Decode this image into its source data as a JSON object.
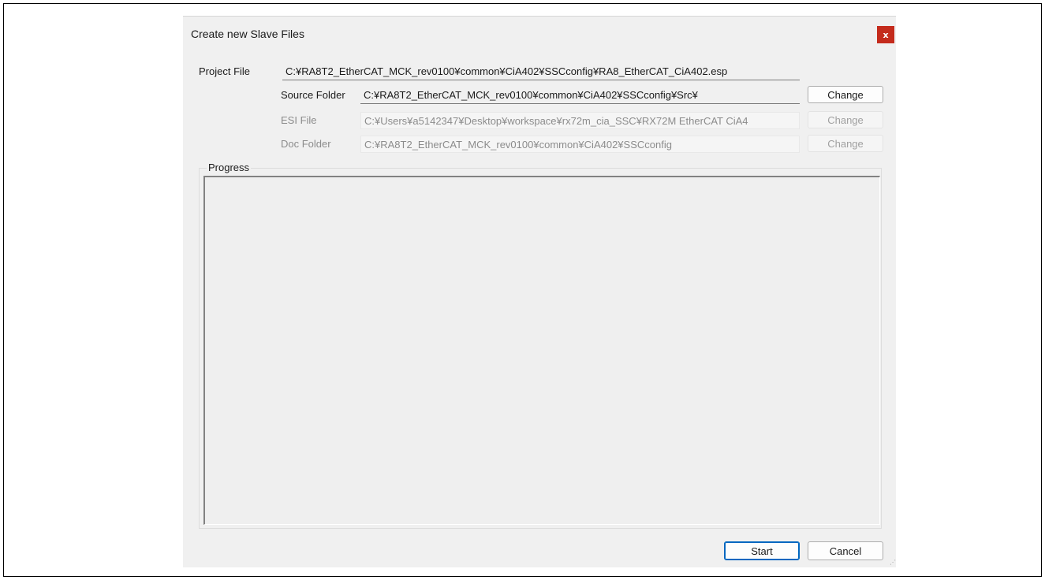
{
  "dialog": {
    "title": "Create new Slave Files",
    "close_label": "x"
  },
  "form": {
    "project_file": {
      "label": "Project File",
      "value": "C:¥RA8T2_EtherCAT_MCK_rev0100¥common¥CiA402¥SSCconfig¥RA8_EtherCAT_CiA402.esp"
    },
    "source_folder": {
      "label": "Source Folder",
      "value": "C:¥RA8T2_EtherCAT_MCK_rev0100¥common¥CiA402¥SSCconfig¥Src¥",
      "button": "Change"
    },
    "esi_file": {
      "label": "ESI File",
      "value": "C:¥Users¥a5142347¥Desktop¥workspace¥rx72m_cia_SSC¥RX72M EtherCAT CiA4",
      "button": "Change"
    },
    "doc_folder": {
      "label": "Doc Folder",
      "value": "C:¥RA8T2_EtherCAT_MCK_rev0100¥common¥CiA402¥SSCconfig",
      "button": "Change"
    }
  },
  "progress": {
    "label": "Progress"
  },
  "footer": {
    "start_label": "Start",
    "cancel_label": "Cancel"
  }
}
